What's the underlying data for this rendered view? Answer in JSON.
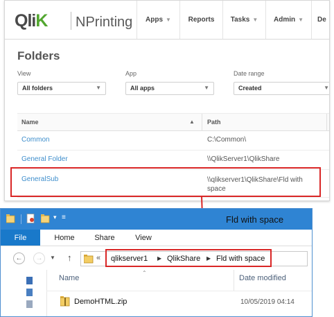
{
  "np": {
    "logo_brand": "Qlik",
    "product": "NPrinting",
    "nav": [
      {
        "label": "Apps",
        "caret": true
      },
      {
        "label": "Reports",
        "caret": false
      },
      {
        "label": "Tasks",
        "caret": true
      },
      {
        "label": "Admin",
        "caret": true
      },
      {
        "label": "De",
        "caret": false
      }
    ],
    "title": "Folders",
    "filters": {
      "view": {
        "label": "View",
        "value": "All folders"
      },
      "app": {
        "label": "App",
        "value": "All apps"
      },
      "date": {
        "label": "Date range",
        "value": "Created"
      }
    },
    "table": {
      "col_name": "Name",
      "col_path": "Path",
      "rows": [
        {
          "name": "Common",
          "path": "C:\\Common\\"
        },
        {
          "name": "General Folder",
          "path": "\\\\QlikServer1\\QlikShare"
        },
        {
          "name": "GeneralSub",
          "path": "\\\\qlikserver1\\QlikShare\\Fld with",
          "path2": "space"
        }
      ]
    }
  },
  "explorer": {
    "window_title": "Fld with space",
    "tabs": [
      "File",
      "Home",
      "Share",
      "View"
    ],
    "overflow_label": "«",
    "breadcrumbs": [
      "qlikserver1",
      "QlikShare",
      "Fld with space"
    ],
    "columns": {
      "name": "Name",
      "date": "Date modified"
    },
    "files": [
      {
        "name": "DemoHTML.zip",
        "date": "10/05/2019 04:14"
      }
    ]
  },
  "colors": {
    "qlik_green": "#52a62f",
    "link_blue": "#3e8ecc",
    "highlight_red": "#d92626",
    "titlebar_blue": "#2f84d3",
    "file_tab_blue": "#1979ca"
  }
}
